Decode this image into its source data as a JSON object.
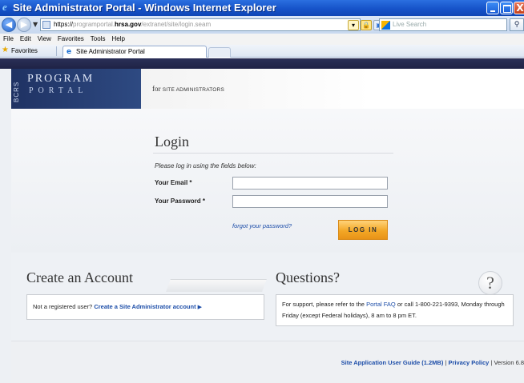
{
  "window": {
    "title": "Site Administrator Portal - Windows Internet Explorer",
    "controls": {
      "close": "X"
    }
  },
  "addressbar": {
    "url_scheme": "https://",
    "url_prefix": "programportal.",
    "url_domain": "hrsa.gov",
    "url_path": "/extranet/site/login.seam",
    "search_placeholder": "Live Search"
  },
  "menubar": {
    "items": [
      "File",
      "Edit",
      "View",
      "Favorites",
      "Tools",
      "Help"
    ]
  },
  "favbar": {
    "label": "Favorites",
    "tab_label": "Site Administrator Portal"
  },
  "site": {
    "logo_vertical": "BCRS",
    "logo_program": "PROGRAM",
    "logo_portal": "PORTAL",
    "for_prefix": "for",
    "for_audience": "SITE ADMINISTRATORS"
  },
  "login": {
    "title": "Login",
    "instructions": "Please log in using the fields below:",
    "email_label": "Your Email *",
    "password_label": "Your Password *",
    "forgot_link": "forgot your password?",
    "button": "LOG IN"
  },
  "create_account": {
    "title": "Create an Account",
    "prompt": "Not a registered user?",
    "link": "Create a Site Administrator account",
    "arrow": "▶"
  },
  "questions": {
    "title": "Questions?",
    "bubble": "?",
    "text_before": "For support, please refer to the",
    "faq_link": "Portal FAQ",
    "text_after": "or call 1-800-221-9393, Monday through Friday (except Federal holidays), 8 am to 8 pm ET."
  },
  "footer": {
    "guide_link": "Site Application User Guide (1.2MB)",
    "sep1": " | ",
    "privacy_link": "Privacy Policy",
    "sep2": " | ",
    "version": "Version 6.8"
  }
}
